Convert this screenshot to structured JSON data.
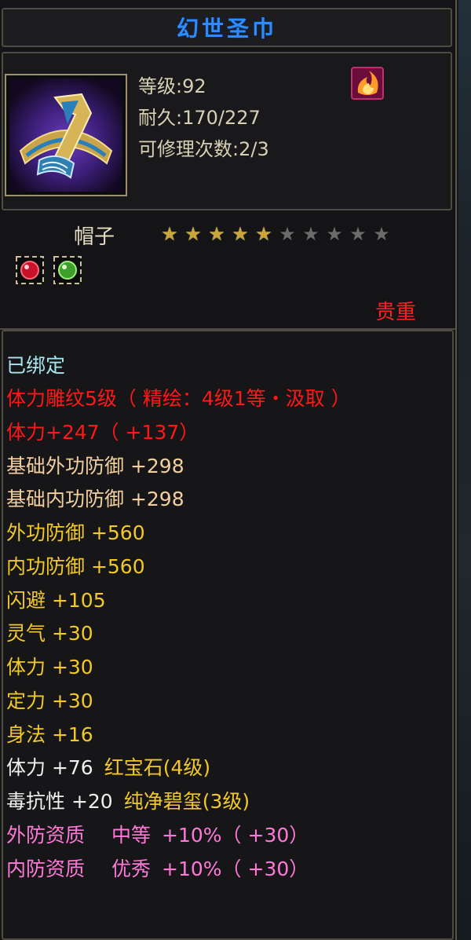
{
  "item": {
    "name": "幻世圣巾",
    "level_label": "等级",
    "level_value": "92",
    "durability_label": "耐久",
    "durability_value": "170/227",
    "repair_label": "可修理次数",
    "repair_value": "2/3",
    "type": "帽子",
    "stars_total": 10,
    "stars_filled": 5,
    "rarity": "贵重"
  },
  "gems": [
    {
      "name": "red-gem-icon",
      "color": "#d11a2a"
    },
    {
      "name": "green-gem-icon",
      "color": "#3fa82a"
    }
  ],
  "stats": [
    {
      "text": "已绑定",
      "style": "c-bound"
    },
    {
      "text": "体力雕纹5级（ 精绘：4级1等・汲取 ）",
      "style": "c-red"
    },
    {
      "text": "体力+247（ +137）",
      "style": "c-red"
    },
    {
      "text": "基础外功防御 +298",
      "style": "c-base"
    },
    {
      "text": "基础内功防御 +298",
      "style": "c-base"
    },
    {
      "text": "外功防御 +560",
      "style": "c-gold"
    },
    {
      "text": "内功防御 +560",
      "style": "c-gold"
    },
    {
      "text": "闪避 +105",
      "style": "c-gold"
    },
    {
      "text": "灵气 +30",
      "style": "c-gold"
    },
    {
      "text": "体力 +30",
      "style": "c-gold"
    },
    {
      "text": "定力 +30",
      "style": "c-gold"
    },
    {
      "text": "身法 +16",
      "style": "c-gold"
    }
  ],
  "gem_stats": [
    {
      "stat": "体力 +76",
      "gem": "红宝石(4级)"
    },
    {
      "stat": "毒抗性 +20",
      "gem": "纯净碧玺(3级)"
    }
  ],
  "qualities": [
    {
      "label": "外防资质",
      "grade": "中等",
      "value": "+10%（ +30）"
    },
    {
      "label": "内防资质",
      "grade": "优秀",
      "value": "+10%（ +30）"
    }
  ],
  "colors": {
    "title": "#2e8cff",
    "rarity": "#ff2020",
    "engrave": "#ff1818",
    "base_stat": "#f2cfa0",
    "attribute": "#f2c82a",
    "quality": "#ff7ad8"
  }
}
